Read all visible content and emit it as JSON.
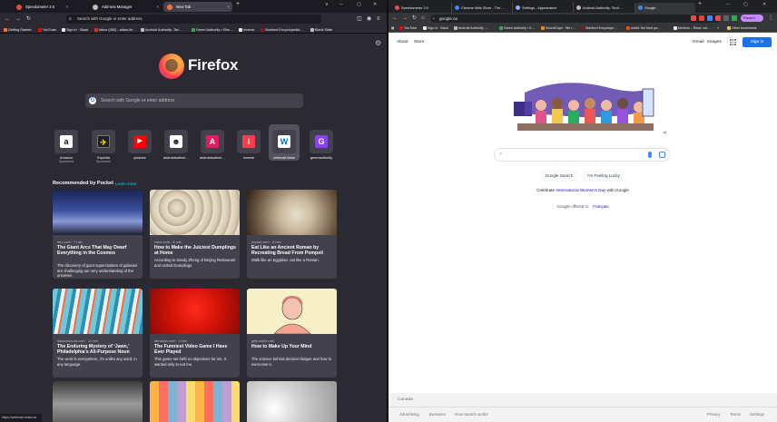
{
  "firefox": {
    "tabs": [
      {
        "label": "Speedometer 2.0",
        "color": "#e54c4c"
      },
      {
        "label": "Add-ons Manager",
        "color": "#bbbbbb"
      },
      {
        "label": "New Tab",
        "color": "#ff7139"
      }
    ],
    "new_tab_symbol": "+",
    "close_symbol": "×",
    "window_controls": {
      "chevron": "∨",
      "minimize": "─",
      "maximize": "▢",
      "close": "✕"
    },
    "url_placeholder": "Search with Google or enter address",
    "bookmarks": [
      {
        "label": "Getting Started",
        "color": "#ff7139"
      },
      {
        "label": "YouTube",
        "color": "#ff0000"
      },
      {
        "label": "Sign in · Slack",
        "color": "#e8e8e8"
      },
      {
        "label": "Inbox (360) - adam.lin…",
        "color": "#d93025"
      },
      {
        "label": "Android Authority -Tec…",
        "color": "#bbbbbb"
      },
      {
        "label": "Green Authority • Elec…",
        "color": "#34a853"
      },
      {
        "label": "Inverse",
        "color": "#e8e8e8"
      },
      {
        "label": "Stanford Encyclopedia…",
        "color": "#8c1515"
      },
      {
        "label": "Blank Slate",
        "color": "#bbbbbb"
      }
    ],
    "brand": "Firefox",
    "search_placeholder": "Search with Google or enter address",
    "top_sites": [
      {
        "name": "Amazon",
        "sponsored": "Sponsored",
        "glyph": "a",
        "bg": "#ffffff",
        "fg": "#111111"
      },
      {
        "name": "Expedia",
        "sponsored": "Sponsored",
        "glyph": "✈",
        "bg": "#1f1f1f",
        "fg": "#ffcc00"
      },
      {
        "name": "youtube",
        "sponsored": "",
        "glyph": "▶",
        "bg": "#ff0000",
        "fg": "#ffffff"
      },
      {
        "name": "androidauthori…",
        "sponsored": "",
        "glyph": "☻",
        "bg": "#ffffff",
        "fg": "#222222"
      },
      {
        "name": "androidauthori…",
        "sponsored": "",
        "glyph": "A",
        "bg": "#e5195e",
        "fg": "#ffffff"
      },
      {
        "name": "inverse",
        "sponsored": "",
        "glyph": "I",
        "bg": "#ff3b4e",
        "fg": "#ffffff"
      },
      {
        "name": "webmail.shaw",
        "sponsored": "",
        "glyph": "W",
        "bg": "#ffffff",
        "fg": "#0073cf"
      },
      {
        "name": "greenauthority",
        "sponsored": "",
        "glyph": "G",
        "bg": "#8a3ffc",
        "fg": "#ffffff"
      }
    ],
    "pocket_heading": "Recommended by Pocket",
    "pocket_link": "Learn more",
    "cards": [
      {
        "source": "bbc.com · 7 min",
        "title": "The Giant Arcs That May Dwarf Everything in the Cosmos",
        "excerpt": "The discovery of giant superclusters of galaxies are challenging our very understanding of the universe."
      },
      {
        "source": "eater.com · 8 min",
        "title": "How to Make the Juiciest Dumplings at Home",
        "excerpt": "According to Sandy Zheng of Beijing Restaurant and United Dumplings."
      },
      {
        "source": "popsci.com · 8 min",
        "title": "Eat Like an Ancient Roman by Recreating Bread From Pompeii",
        "excerpt": "Walk like an Egyptian, eat like a Roman."
      },
      {
        "source": "atlasobscura.com · 11 min",
        "title": "The Enduring Mystery of ‘Jawn,’ Philadelphia’s All-Purpose Noun",
        "excerpt": "The word is everywhere, it’s unlike any word, in any language."
      },
      {
        "source": "abnation.com · 3 min",
        "title": "The Funniest Video Game I Have Ever Played",
        "excerpt": "This game set forth no objectives for me. It wanted only to eat me."
      },
      {
        "source": "getpocket.com",
        "title": "How to Make Up Your Mind",
        "excerpt": "The science behind decision fatigue and how to overcome it."
      }
    ],
    "status_url": "https://webmail.shaw.ca"
  },
  "chrome": {
    "tabs": [
      {
        "label": "Speedometer 2.0",
        "color": "#e54c4c"
      },
      {
        "label": "Chrome Web Store - The…",
        "color": "#4285f4"
      },
      {
        "label": "Settings - Appearance",
        "color": "#8ab4f8"
      },
      {
        "label": "Android Authority: Tech…",
        "color": "#bbbbbb"
      },
      {
        "label": "Google",
        "color": "#4285f4"
      }
    ],
    "url": "google.ca",
    "profile_label": "Paused",
    "bookmarks": [
      {
        "label": "YouTube",
        "color": "#ff0000"
      },
      {
        "label": "Sign in · Slack",
        "color": "#e8e8e8"
      },
      {
        "label": "Android Authority -…",
        "color": "#bbbbbb"
      },
      {
        "label": "Green Authority • E…",
        "color": "#34a853"
      },
      {
        "label": "SoundCups · We t…",
        "color": "#ff8800"
      },
      {
        "label": "Stanford Encyclope…",
        "color": "#8c1515"
      },
      {
        "label": "reddit: the front pa…",
        "color": "#ff4500"
      },
      {
        "label": "Medium – Read, wri…",
        "color": "#e8e8e8"
      }
    ],
    "other_bookmarks": "Other bookmarks",
    "overflow": "»"
  },
  "google": {
    "about": "About",
    "store": "Store",
    "gmail": "Gmail",
    "images": "Images",
    "signin": "Sign in",
    "search_button": "Google Search",
    "lucky_button": "I'm Feeling Lucky",
    "celebrate_prefix": "Celebrate ",
    "celebrate_link": "International Women's Day",
    "celebrate_suffix": " with Google",
    "offered_in": "Google offered in:",
    "language": "Français",
    "country": "Canada",
    "footer_left": [
      "Advertising",
      "Business",
      "How Search works"
    ],
    "footer_right": [
      "Privacy",
      "Terms",
      "Settings"
    ]
  }
}
